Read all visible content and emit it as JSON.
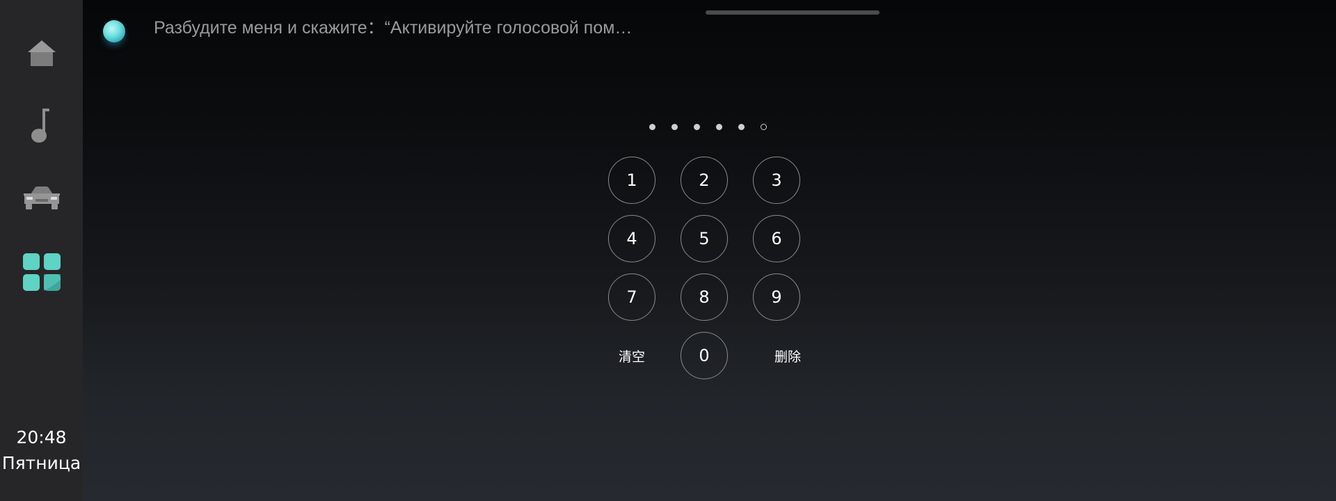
{
  "sidebar": {
    "items": [
      {
        "icon": "home-icon",
        "color": "#8e8e8e"
      },
      {
        "icon": "music-note-icon",
        "color": "#8e8e8e"
      },
      {
        "icon": "car-icon",
        "color": "#8e8e8e"
      },
      {
        "icon": "apps-grid-icon",
        "color": "#5fd3c4"
      }
    ],
    "clock": {
      "time": "20:48",
      "day": "Пятница"
    }
  },
  "voice": {
    "hint": "Разбудите меня и скажите：“Активируйте голосовой пом…"
  },
  "pin": {
    "total_digits": 6,
    "entered_digits": 5
  },
  "keypad": {
    "keys": [
      "1",
      "2",
      "3",
      "4",
      "5",
      "6",
      "7",
      "8",
      "9"
    ],
    "zero": "0",
    "clear_label": "清空",
    "delete_label": "删除"
  },
  "colors": {
    "sidebar_bg": "#262628",
    "accent": "#5fd3c4",
    "text": "#ffffff",
    "hint_text": "#9a9a9a"
  }
}
